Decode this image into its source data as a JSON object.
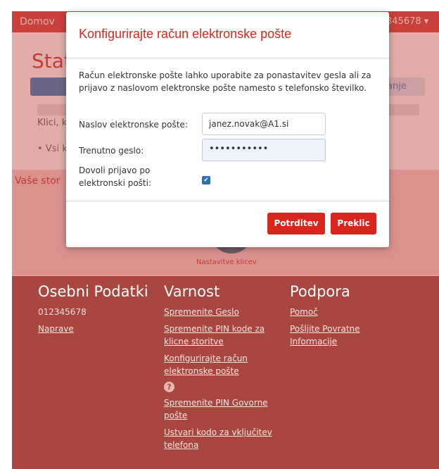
{
  "topbar": {
    "home": "Domov",
    "account": "345678 ▾"
  },
  "background": {
    "title": "Stat",
    "tab_right": "anje",
    "line1": "Klici, k",
    "line2": "• Vsi k",
    "services": "Vaše stor",
    "settings_caption": "Nastavitve klicev"
  },
  "modal": {
    "title": "Konfigurirajte račun elektronske pošte",
    "description": "Račun elektronske pošte lahko uporabite za ponastavitev gesla ali za prijavo z naslovom elektronske pošte namesto s telefonsko številko.",
    "email_label": "Naslov elektronske pošte:",
    "email_value": "janez.novak@A1.si",
    "password_label": "Trenutno geslo:",
    "password_value": "•••••••••••",
    "login_label": "Dovoli prijavo po elektronski pošti:",
    "login_checked": true,
    "confirm_label": "Potrditev",
    "cancel_label": "Preklic"
  },
  "footer": {
    "personal": {
      "title": "Osebni Podatki",
      "number": "012345678",
      "devices": "Naprave"
    },
    "security": {
      "title": "Varnost",
      "links": [
        "Spremenite Geslo",
        "Spremenite PIN kode za klicne storitve",
        "Konfigurirajte račun elektronske pošte",
        "Spremenite PIN Govorne pošte",
        "Ustvari kodo za vključitev telefona"
      ],
      "help_icon": "question-circle-icon"
    },
    "support": {
      "title": "Podpora",
      "links": [
        "Pomoč",
        "Pošljite Povratne Informacije"
      ]
    }
  },
  "colors": {
    "brand_red": "#d9261c",
    "footer": "#a8463f",
    "checkbox": "#2e6fb2"
  }
}
